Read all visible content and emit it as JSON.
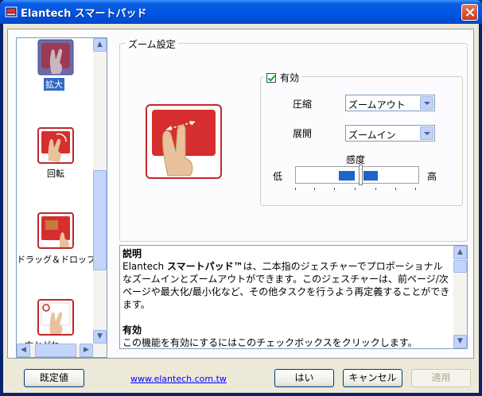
{
  "window": {
    "title": "Elantech スマートパッド"
  },
  "gesture_list": {
    "items": [
      {
        "label": "拡大",
        "selected": true
      },
      {
        "label": "回転",
        "selected": false
      },
      {
        "label": "ドラッグ＆ドロップ",
        "selected": false
      },
      {
        "label": "中かがね",
        "selected": false
      }
    ]
  },
  "zoom_settings": {
    "group_title": "ズーム設定",
    "enable_label": "有効",
    "enable_checked": true,
    "pinch_label": "圧縮",
    "pinch_value": "ズームアウト",
    "spread_label": "展開",
    "spread_value": "ズームイン",
    "sensitivity_label": "感度",
    "low_label": "低",
    "high_label": "高",
    "sensitivity_level": 0.5
  },
  "description": {
    "heading": "説明",
    "product": "スマートパッド",
    "tm": "™",
    "brand": "Elantech ",
    "body": "は、二本指のジェスチャーでプロポーショナルなズームインとズームアウトができます。このジェスチャーは、前ページ/次ページや最大化/最小化など、その他タスクを行うよう再定義することができます。",
    "enable_heading": "有効",
    "enable_body": "この機能を有効にするにはこのチェックボックスをクリックします。"
  },
  "footer": {
    "default_button": "既定値",
    "link": "www.elantech.com.tw",
    "ok_button": "はい",
    "cancel_button": "キャンセル",
    "apply_button": "適用"
  },
  "colors": {
    "accent_red": "#C1272D",
    "selection_blue": "#316AC5",
    "title_blue": "#0054E3"
  }
}
